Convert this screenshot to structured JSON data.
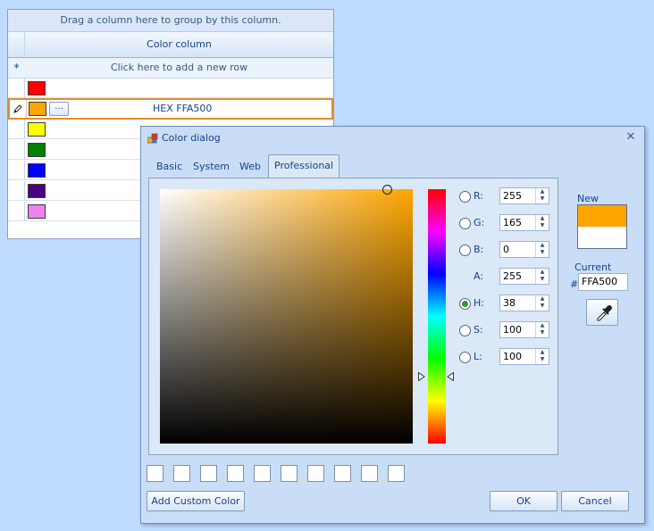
{
  "grid": {
    "group_panel_text": "Drag a column here to group by this column.",
    "column_header": "Color column",
    "new_row_text": "Click here to add a new row",
    "new_row_marker": "*",
    "edit_button_label": "...",
    "editing_value": "HEX FFA500",
    "rows": [
      {
        "color": "#ff0000"
      },
      {
        "color": "#ffa500"
      },
      {
        "color": "#ffff00"
      },
      {
        "color": "#008000"
      },
      {
        "color": "#0000ff"
      },
      {
        "color": "#4b0082"
      },
      {
        "color": "#ee82ee"
      }
    ]
  },
  "dialog": {
    "title": "Color dialog",
    "close_glyph": "✕",
    "tabs": [
      "Basic",
      "System",
      "Web",
      "Professional"
    ],
    "active_tab": "Professional",
    "channels": [
      {
        "label": "R:",
        "value": "255",
        "radio": true,
        "checked": false
      },
      {
        "label": "G:",
        "value": "165",
        "radio": true,
        "checked": false
      },
      {
        "label": "B:",
        "value": "0",
        "radio": true,
        "checked": false
      },
      {
        "label": "A:",
        "value": "255",
        "radio": false,
        "checked": false
      },
      {
        "label": "H:",
        "value": "38",
        "radio": true,
        "checked": true
      },
      {
        "label": "S:",
        "value": "100",
        "radio": true,
        "checked": false
      },
      {
        "label": "L:",
        "value": "100",
        "radio": true,
        "checked": false
      }
    ],
    "new_label": "New",
    "current_label": "Current",
    "hash": "#",
    "hex_value": "FFA500",
    "new_color": "#ffa500",
    "custom_color_slots": 10,
    "add_custom_color_label": "Add Custom Color",
    "ok_label": "OK",
    "cancel_label": "Cancel"
  }
}
